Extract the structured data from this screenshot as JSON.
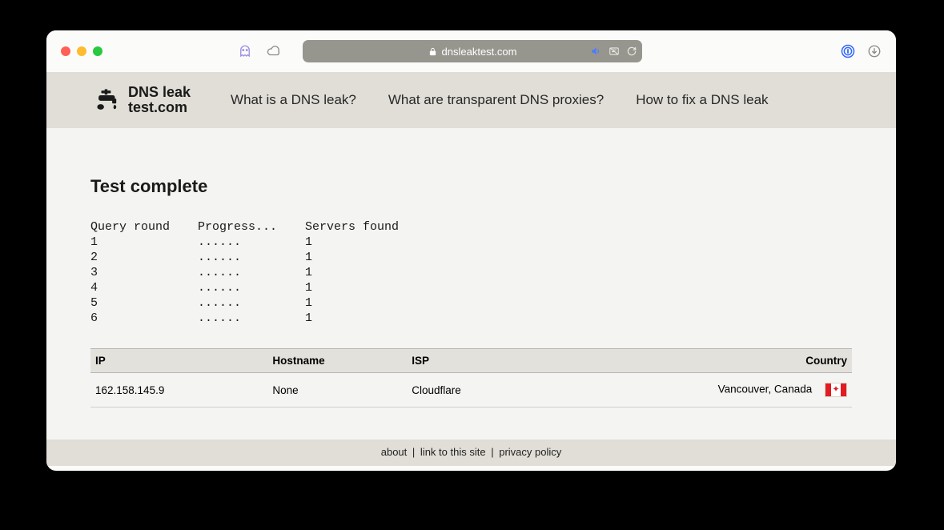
{
  "browser": {
    "url": "dnsleaktest.com"
  },
  "header": {
    "logo_line1": "DNS leak",
    "logo_line2": "test.com",
    "nav": [
      "What is a DNS leak?",
      "What are transparent DNS proxies?",
      "How to fix a DNS leak"
    ]
  },
  "page": {
    "title": "Test complete",
    "columns": {
      "round": "Query round",
      "progress": "Progress...",
      "servers": "Servers found"
    },
    "rows": [
      {
        "round": "1",
        "progress": "......",
        "servers": "1"
      },
      {
        "round": "2",
        "progress": "......",
        "servers": "1"
      },
      {
        "round": "3",
        "progress": "......",
        "servers": "1"
      },
      {
        "round": "4",
        "progress": "......",
        "servers": "1"
      },
      {
        "round": "5",
        "progress": "......",
        "servers": "1"
      },
      {
        "round": "6",
        "progress": "......",
        "servers": "1"
      }
    ]
  },
  "results": {
    "headers": {
      "ip": "IP",
      "hostname": "Hostname",
      "isp": "ISP",
      "country": "Country"
    },
    "rows": [
      {
        "ip": "162.158.145.9",
        "hostname": "None",
        "isp": "Cloudflare",
        "country": "Vancouver, Canada",
        "flag": "canada"
      }
    ]
  },
  "footer": {
    "about": "about",
    "link": "link to this site",
    "privacy": "privacy policy"
  }
}
